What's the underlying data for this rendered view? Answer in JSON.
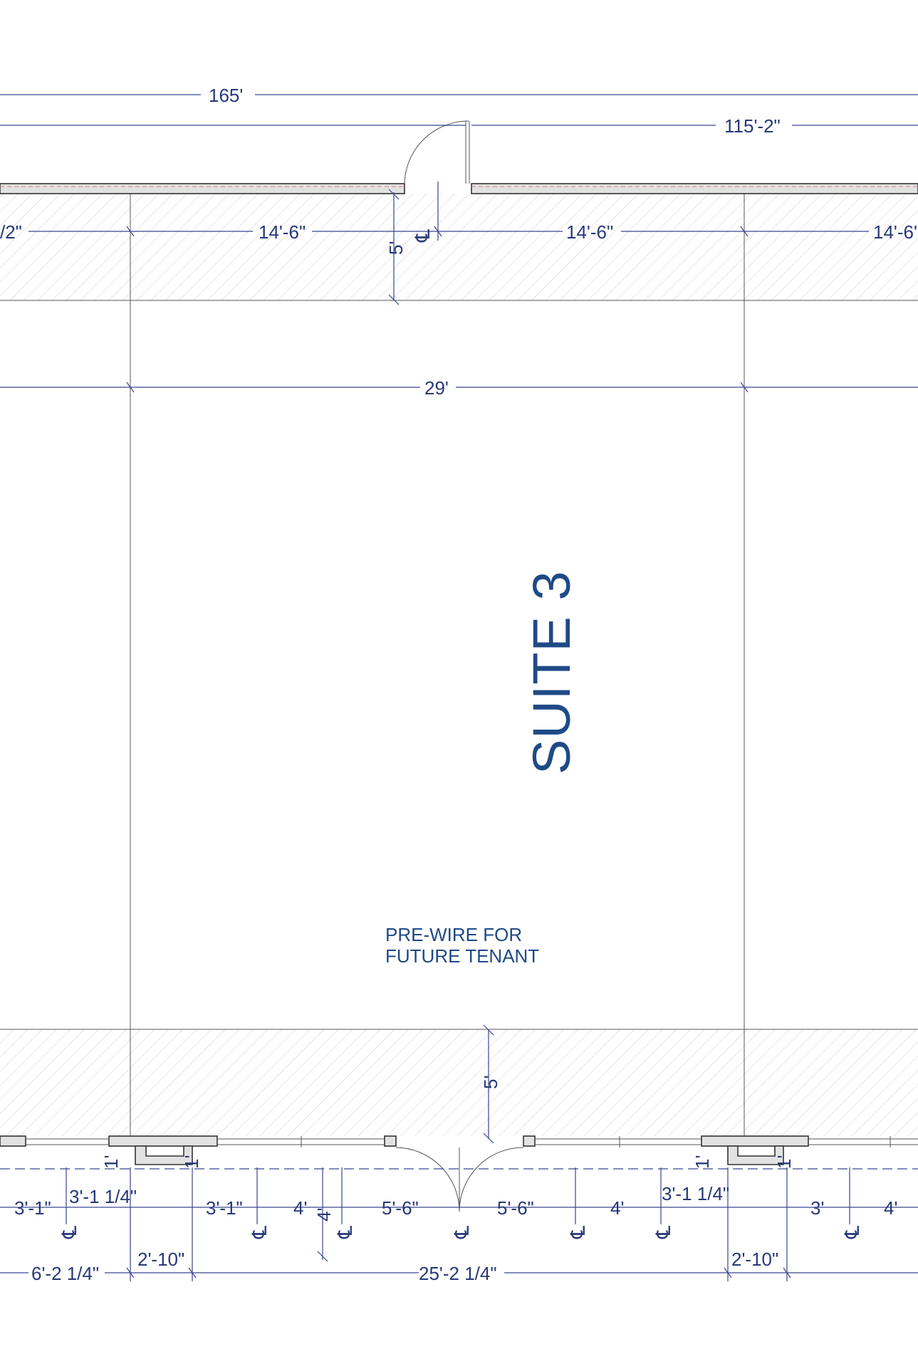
{
  "drawing": {
    "suite_label": "SUITE 3",
    "note_line1": "PRE-WIRE FOR",
    "note_line2": "FUTURE TENANT"
  },
  "dimensions": {
    "overall": "165'",
    "right_segment": "115'-2\"",
    "left_partial": "/2\"",
    "bay_left": "14'-6\"",
    "bay_right": "14'-6\"",
    "bay_far_right": "14'-6'",
    "top_depth": "5'",
    "suite_width": "29'",
    "bottom_depth": "5'",
    "col_offset_l": "1'",
    "col_offset_l2": "1'",
    "col_offset_r": "1'",
    "col_offset_r2": "1'",
    "b1": "3'-1\"",
    "b2": "3'-1 1/4\"",
    "b3": "3'-1\"",
    "b4": "4'",
    "b5": "4'",
    "b6": "5'-6\"",
    "b7": "5'-6\"",
    "b8": "4'",
    "b9": "3'-1 1/4\"",
    "b10": "3'",
    "b11": "4'",
    "c1": "6'-2 1/4\"",
    "c2": "2'-10\"",
    "c3": "25'-2 1/4\"",
    "c4": "2'-10\""
  },
  "centerline_symbol": "℄",
  "colors": {
    "ink": "#283878",
    "label": "#1f4a86",
    "hatch": "#c8c8c8",
    "wall_fill": "#e2e2e2"
  }
}
